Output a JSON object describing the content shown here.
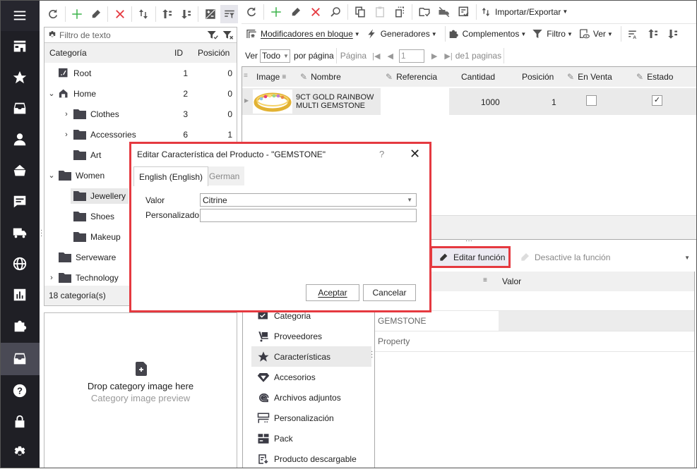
{
  "nav": {
    "items": [
      "menu",
      "store",
      "favorites",
      "orders",
      "customers",
      "baskets",
      "messages",
      "shipping",
      "localization",
      "statistics",
      "modules",
      "products",
      "help",
      "security",
      "settings"
    ],
    "active": "products"
  },
  "categories": {
    "filter_placeholder": "Filtro de texto",
    "headers": {
      "name": "Categoría",
      "id": "ID",
      "position": "Posición"
    },
    "rows": [
      {
        "name": "Root",
        "id": "1",
        "position": "0",
        "level": 0,
        "expander": "",
        "icon": "root"
      },
      {
        "name": "Home",
        "id": "2",
        "position": "0",
        "level": 0,
        "expander": "open",
        "icon": "home"
      },
      {
        "name": "Clothes",
        "id": "3",
        "position": "0",
        "level": 1,
        "expander": "closed",
        "icon": "folder"
      },
      {
        "name": "Accessories",
        "id": "6",
        "position": "1",
        "level": 1,
        "expander": "closed",
        "icon": "folder"
      },
      {
        "name": "Art",
        "id": "",
        "position": "",
        "level": 1,
        "expander": "",
        "icon": "folder"
      },
      {
        "name": "Women",
        "id": "",
        "position": "",
        "level": 0,
        "expander": "open",
        "icon": "folder"
      },
      {
        "name": "Jewellery",
        "id": "",
        "position": "",
        "level": 1,
        "expander": "",
        "icon": "folder",
        "selected": true
      },
      {
        "name": "Shoes",
        "id": "",
        "position": "",
        "level": 1,
        "expander": "",
        "icon": "folder"
      },
      {
        "name": "Makeup",
        "id": "",
        "position": "",
        "level": 1,
        "expander": "",
        "icon": "folder"
      },
      {
        "name": "Serveware",
        "id": "",
        "position": "",
        "level": 0,
        "expander": "",
        "icon": "folder"
      },
      {
        "name": "Technology",
        "id": "",
        "position": "",
        "level": 0,
        "expander": "closed",
        "icon": "folder"
      }
    ],
    "footer": "18 categoría(s)"
  },
  "drop": {
    "title": "Drop category image here",
    "subtitle": "Category image preview"
  },
  "toolbar": {
    "import_export": "Importar/Exportar",
    "bulk": "Modificadores en bloque",
    "generators": "Generadores",
    "addons": "Complementos",
    "filter": "Filtro",
    "view": "Ver"
  },
  "pager": {
    "show_label": "Ver",
    "show_value": "Todo",
    "per_page": "por página",
    "page_label": "Página",
    "page_value": "1",
    "of_pages": "de1 paginas"
  },
  "products": {
    "headers": [
      "Image",
      "Nombre",
      "Referencia",
      "Cantidad",
      "Posición",
      "En Venta",
      "Estado"
    ],
    "rows": [
      {
        "name_line1": "9CT GOLD RAINBOW",
        "name_line2": "MULTI GEMSTONE",
        "reference": "",
        "quantity": "1000",
        "position": "1",
        "on_sale": false,
        "status": true
      }
    ]
  },
  "features": {
    "edit_button": "Editar función",
    "disable_button": "Desactive la función",
    "value_header": "Valor",
    "rows": [
      "GEMSTONE",
      "Property"
    ]
  },
  "sections": [
    "Categoria",
    "Proveedores",
    "Características",
    "Accesorios",
    "Archivos adjuntos",
    "Personalización",
    "Pack",
    "Producto descargable"
  ],
  "sections_selected": "Características",
  "dialog": {
    "title": "Editar Característica del Producto - \"GEMSTONE\"",
    "help": "?",
    "close": "✕",
    "tabs": [
      "English (English)",
      "German"
    ],
    "value_label": "Valor",
    "value": "Citrine",
    "custom_label": "Personalizado",
    "custom_value": "",
    "ok": "Aceptar",
    "cancel": "Cancelar"
  },
  "colors": {
    "accent_red": "#e53940",
    "nav_bg": "#1f1f25",
    "add_green": "#3bb44a",
    "delete_red": "#e53940"
  }
}
